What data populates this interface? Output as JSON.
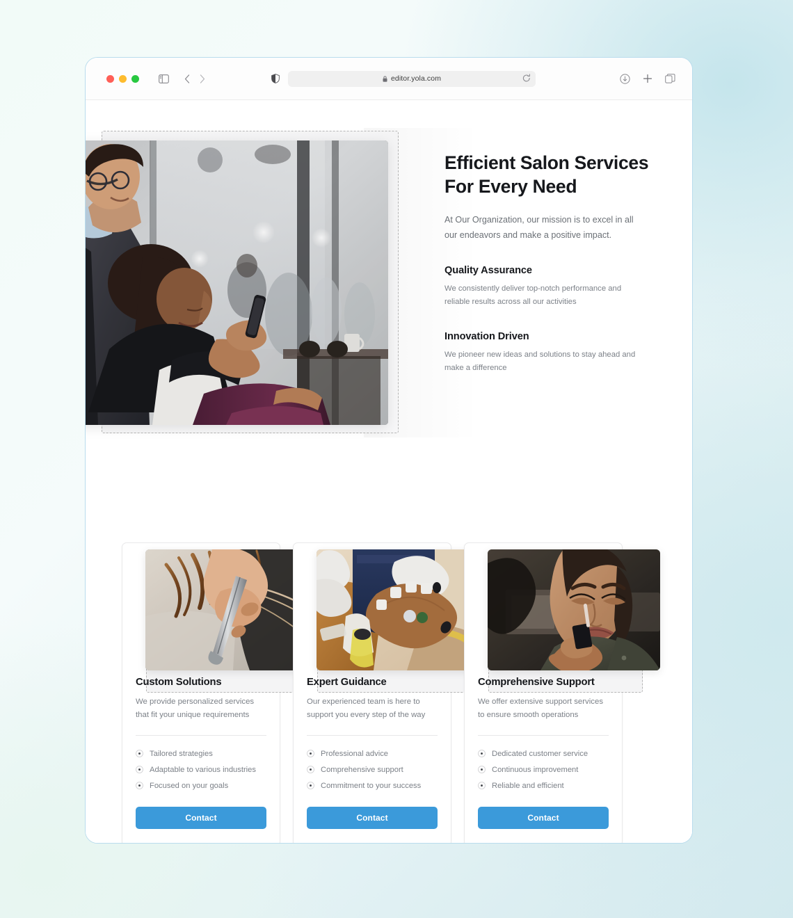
{
  "browser": {
    "traffic_lights": [
      "close",
      "minimize",
      "maximize"
    ],
    "url": "editor.yola.com",
    "icons": {
      "sidebar": "sidebar-toggle-icon",
      "back": "chevron-left-icon",
      "forward": "chevron-right-icon",
      "shield": "shield-privacy-icon",
      "lock": "lock-icon",
      "reload": "reload-icon",
      "downloads": "download-circle-icon",
      "new_tab": "plus-icon",
      "tab_overview": "tab-overview-icon"
    }
  },
  "hero": {
    "image_alt": "salon stylist with seated client holding phone",
    "title": "Efficient Salon Services For Every Need",
    "subtitle": "At Our Organization, our mission is to excel in all our endeavors and make a positive impact.",
    "features": [
      {
        "title": "Quality Assurance",
        "body": "We consistently deliver top-notch performance and reliable results across all our activities"
      },
      {
        "title": "Innovation Driven",
        "body": "We pioneer new ideas and solutions to stay ahead and make a difference"
      }
    ]
  },
  "cards": [
    {
      "image_alt": "hands cutting hair with scissors",
      "title": "Custom Solutions",
      "desc": "We provide personalized services that fit your unique requirements",
      "bullets": [
        "Tailored strategies",
        "Adaptable to various industries",
        "Focused on your goals"
      ],
      "button": "Contact"
    },
    {
      "image_alt": "manicure nail service with gloved hands",
      "title": "Expert Guidance",
      "desc": "Our experienced team is here to support you every step of the way",
      "bullets": [
        "Professional advice",
        "Comprehensive support",
        "Commitment to your success"
      ],
      "button": "Contact"
    },
    {
      "image_alt": "makeup artist applying lip gloss",
      "title": "Comprehensive Support",
      "desc": "We offer extensive support services to ensure smooth operations",
      "bullets": [
        "Dedicated customer service",
        "Continuous improvement",
        "Reliable and efficient"
      ],
      "button": "Contact"
    }
  ],
  "colors": {
    "accent": "#3b9ada",
    "heading": "#16181c",
    "body_text": "#7c8188",
    "window_border": "#b9dced"
  }
}
